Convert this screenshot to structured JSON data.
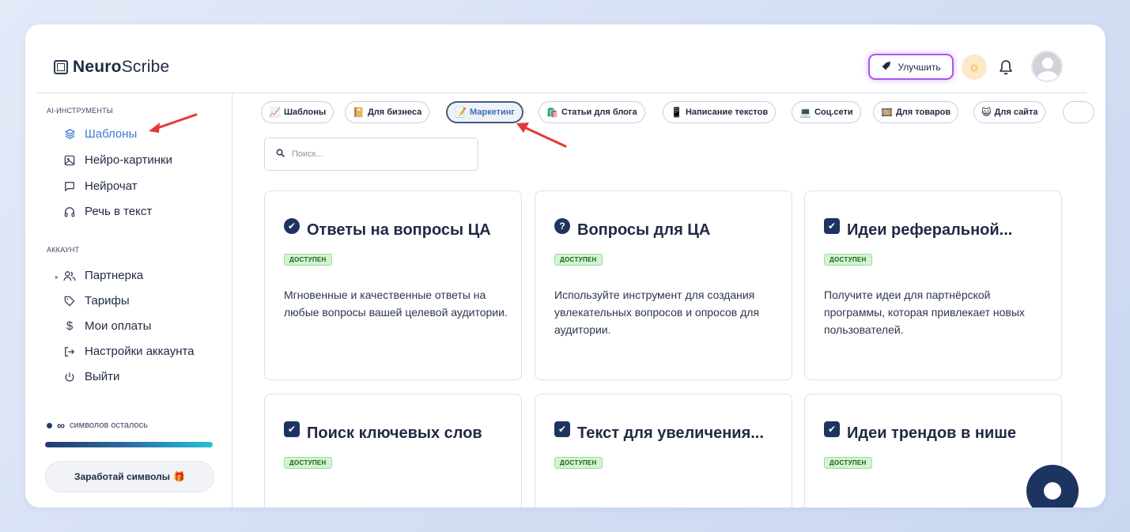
{
  "brand": {
    "bold": "Neuro",
    "regular": "Scribe"
  },
  "header": {
    "upgrade_label": "Улучшить"
  },
  "sidebar": {
    "section_tools": "AI-ИНСТРУМЕНТЫ",
    "tools": [
      {
        "label": "Шаблоны",
        "icon": "layers-icon"
      },
      {
        "label": "Нейро-картинки",
        "icon": "image-icon"
      },
      {
        "label": "Нейрочат",
        "icon": "chat-icon"
      },
      {
        "label": "Речь в текст",
        "icon": "headphones-icon"
      }
    ],
    "section_account": "АККАУНТ",
    "account": [
      {
        "label": "Партнерка",
        "icon": "users-icon"
      },
      {
        "label": "Тарифы",
        "icon": "tag-icon"
      },
      {
        "label": "Мои оплаты",
        "icon": "dollar-icon"
      },
      {
        "label": "Настройки аккаунта",
        "icon": "login-icon"
      },
      {
        "label": "Выйти",
        "icon": "power-icon"
      }
    ],
    "credits_value": "∞",
    "credits_label": "символов осталось",
    "earn_label": "Заработай символы"
  },
  "chips": [
    {
      "emoji": "📈",
      "label": "Шаблоны"
    },
    {
      "emoji": "📔",
      "label": "Для бизнеса"
    },
    {
      "emoji": "📝",
      "label": "Маркетинг"
    },
    {
      "emoji": "🛍️",
      "label": "Статьи для блога"
    },
    {
      "emoji": "📱",
      "label": "Написание текстов"
    },
    {
      "emoji": "💻",
      "label": "Соц.сети"
    },
    {
      "emoji": "🎞️",
      "label": "Для товаров"
    },
    {
      "emoji": "😺",
      "label": "Для сайта"
    }
  ],
  "search": {
    "placeholder": "Поиск..."
  },
  "cards": [
    {
      "title": "Ответы на вопросы ЦА",
      "badge": "ДОСТУПЕН",
      "desc": "Мгновенные и качественные ответы на любые вопросы вашей целевой аудитории.",
      "icon": "check-circle-icon"
    },
    {
      "title": "Вопросы для ЦА",
      "badge": "ДОСТУПЕН",
      "desc": "Используйте инструмент для создания увлекательных вопросов и опросов для аудитории.",
      "icon": "question-circle-icon"
    },
    {
      "title": "Идеи реферальной...",
      "badge": "ДОСТУПЕН",
      "desc": "Получите идеи для партнёрской программы, которая привлекает новых пользователей.",
      "icon": "check-box-icon"
    },
    {
      "title": "Поиск ключевых слов",
      "badge": "ДОСТУПЕН",
      "desc": "",
      "icon": "check-box-icon"
    },
    {
      "title": "Текст для увеличения...",
      "badge": "ДОСТУПЕН",
      "desc": "",
      "icon": "check-box-icon"
    },
    {
      "title": "Идеи трендов в нише",
      "badge": "ДОСТУПЕН",
      "desc": "",
      "icon": "check-box-icon"
    }
  ]
}
